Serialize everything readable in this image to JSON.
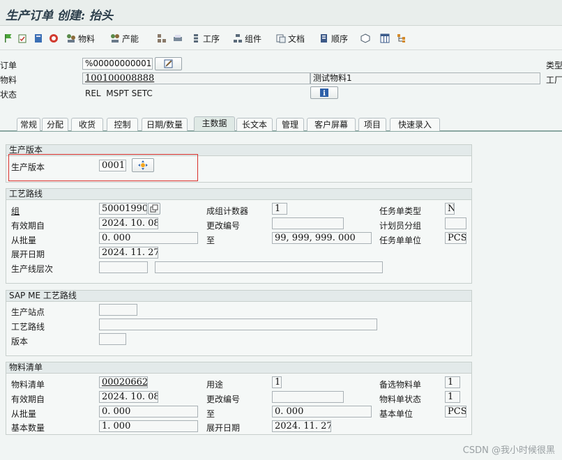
{
  "title": "生产订单 创建: 抬头",
  "toolbar": {
    "material": "物料",
    "capacity": "产能",
    "operation": "工序",
    "component": "组件",
    "document": "文档",
    "sequence": "顺序"
  },
  "header": {
    "order_label": "订单",
    "order_value": "%00000000001",
    "material_label": "物料",
    "material_value": "100100008888",
    "material_desc": "测试物料1",
    "status_label": "状态",
    "status_value": "REL  MSPT SETC",
    "type_label": "类型",
    "plant_label": "工厂"
  },
  "tabs": [
    "常规",
    "分配",
    "收货",
    "控制",
    "日期/数量",
    "主数据",
    "长文本",
    "管理",
    "客户屏幕",
    "项目",
    "快速录入"
  ],
  "active_tab": "主数据",
  "prod_version": {
    "title": "生产版本",
    "label": "生产版本",
    "value": "0001"
  },
  "routing": {
    "title": "工艺路线",
    "group_label": "组",
    "group_value": "50001990",
    "valid_from_label": "有效期自",
    "valid_from_value": "2024. 10. 08",
    "from_lot_label": "从批量",
    "from_lot_value": "0. 000",
    "explode_date_label": "展开日期",
    "explode_date_value": "2024. 11. 27",
    "line_level_label": "生产线层次",
    "group_counter_label": "成组计数器",
    "group_counter_value": "1",
    "change_no_label": "更改编号",
    "change_no_value": "",
    "to_label": "至",
    "to_value": "99, 999, 999. 000",
    "task_type_label": "任务单类型",
    "task_type_value": "N",
    "planner_group_label": "计划员分组",
    "planner_group_value": "",
    "task_unit_label": "任务单单位",
    "task_unit_value": "PCS"
  },
  "sapme": {
    "title": "SAP ME 工艺路线",
    "station_label": "生产站点",
    "routing_label": "工艺路线",
    "version_label": "版本"
  },
  "bom": {
    "title": "物料清单",
    "bom_label": "物料清单",
    "bom_value": "00020662",
    "valid_from_label": "有效期自",
    "valid_from_value": "2024. 10. 08",
    "from_lot_label": "从批量",
    "from_lot_value": "0. 000",
    "base_qty_label": "基本数量",
    "base_qty_value": "1. 000",
    "usage_label": "用途",
    "usage_value": "1",
    "change_no_label": "更改编号",
    "to_label": "至",
    "to_value": "0. 000",
    "explode_date_label": "展开日期",
    "explode_date_value": "2024. 11. 27",
    "alt_bom_label": "备选物料单",
    "alt_bom_value": "1",
    "bom_status_label": "物料单状态",
    "bom_status_value": "1",
    "base_unit_label": "基本单位",
    "base_unit_value": "PCS"
  },
  "watermark": "CSDN @我小时候很黑"
}
